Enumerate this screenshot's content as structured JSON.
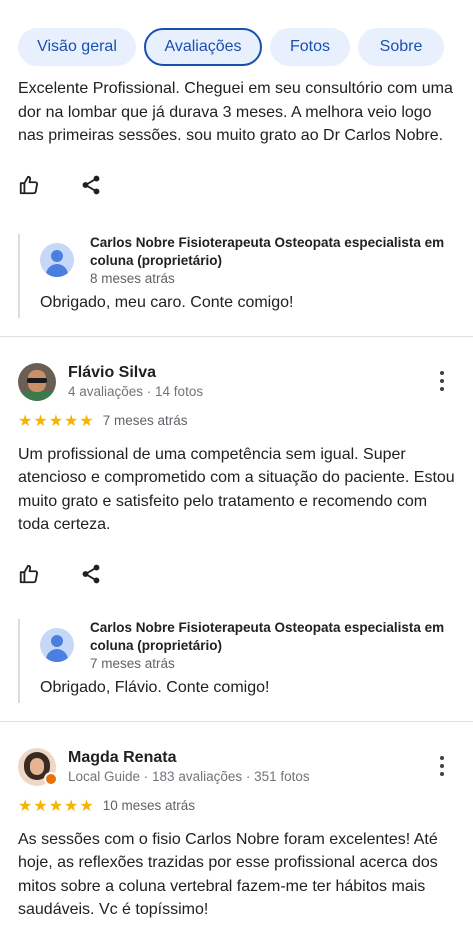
{
  "tabs": [
    {
      "label": "Visão geral",
      "active": false
    },
    {
      "label": "Avaliações",
      "active": true
    },
    {
      "label": "Fotos",
      "active": false
    },
    {
      "label": "Sobre",
      "active": false
    }
  ],
  "reviews": [
    {
      "text": "Excelente Profissional. Cheguei em seu consultório com uma dor na lombar que já durava 3 meses. A melhora veio logo nas primeiras sessões. sou muito grato ao Dr Carlos Nobre.",
      "reply": {
        "author": "Carlos Nobre Fisioterapeuta Osteopata especialista em coluna (proprietário)",
        "date": "8 meses atrás",
        "text": "Obrigado, meu caro. Conte comigo!"
      }
    },
    {
      "name": "Flávio Silva",
      "subtitle": "4 avaliações · 14 fotos",
      "stars": "★★★★★",
      "rating": 5,
      "date": "7 meses atrás",
      "text": "Um profissional de uma competência sem igual. Super atencioso e comprometido com a situação do paciente. Estou muito grato e satisfeito pelo tratamento e recomendo com toda certeza.",
      "reply": {
        "author": "Carlos Nobre Fisioterapeuta Osteopata especialista em coluna (proprietário)",
        "date": "7 meses atrás",
        "text": "Obrigado, Flávio. Conte comigo!"
      }
    },
    {
      "name": "Magda Renata",
      "subtitle": "Local Guide · 183 avaliações · 351 fotos",
      "stars": "★★★★★",
      "rating": 5,
      "date": "10 meses atrás",
      "text": "As sessões com o fisio Carlos Nobre foram excelentes! Até hoje, as reflexões trazidas por esse profissional acerca dos mitos sobre a coluna vertebral fazem-me ter hábitos mais saudáveis. Vc é topíssimo!"
    }
  ],
  "icons": {
    "like": "thumb-up-icon",
    "share": "share-icon",
    "more": "more-vert-icon"
  },
  "colors": {
    "accent": "#1a4fb0",
    "tab_bg": "#e8f0fe",
    "star": "#f6b400"
  }
}
